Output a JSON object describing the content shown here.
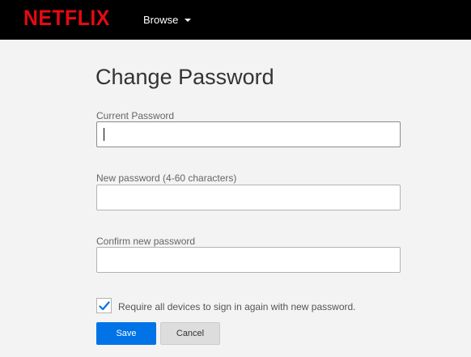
{
  "header": {
    "logo": "NETFLIX",
    "browse_label": "Browse"
  },
  "page": {
    "title": "Change Password"
  },
  "form": {
    "current_password": {
      "label": "Current Password",
      "value": ""
    },
    "new_password": {
      "label": "New password (4-60 characters)",
      "value": ""
    },
    "confirm_password": {
      "label": "Confirm new password",
      "value": ""
    },
    "require_signin": {
      "label": "Require all devices to sign in again with new password.",
      "checked": true
    },
    "save_label": "Save",
    "cancel_label": "Cancel"
  },
  "colors": {
    "brand": "#e50914",
    "primary_button": "#0073e6",
    "checkmark": "#0073e6"
  },
  "icons": {
    "browse_dropdown": "chevron-down-icon",
    "checkbox": "checkmark-icon"
  }
}
